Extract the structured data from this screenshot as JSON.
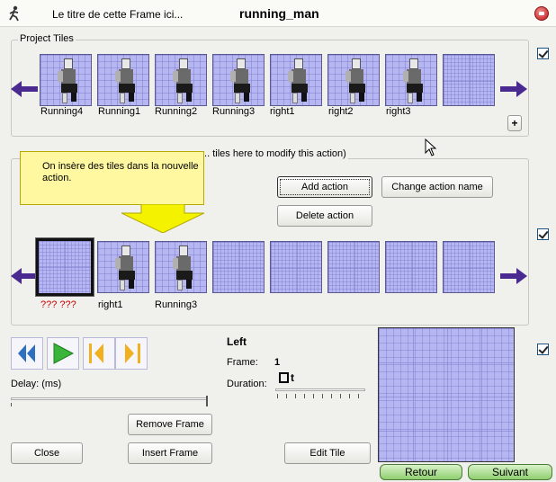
{
  "window": {
    "title": "Le titre de cette Frame ici...",
    "name": "running_man"
  },
  "project_tiles": {
    "label": "Project Tiles",
    "tiles": [
      "Running4",
      "Running1",
      "Running2",
      "Running3",
      "right1",
      "right2",
      "right3",
      ""
    ],
    "add_label": "+"
  },
  "action_group": {
    "label_visible": "... tiles here to modify this action)",
    "tooltip": "On insère des tiles dans la nouvelle action.",
    "add_action": "Add action",
    "change_action_name": "Change action name",
    "delete_action": "Delete action",
    "frames": [
      "??? ???",
      "right1",
      "Running3",
      "",
      "",
      "",
      "",
      ""
    ]
  },
  "controls": {
    "delay_label": "Delay: (ms)",
    "remove_frame": "Remove Frame",
    "insert_frame": "Insert Frame",
    "close": "Close",
    "edit_tile": "Edit Tile",
    "direction": "Left",
    "frame_label": "Frame:",
    "frame_value": "1",
    "duration_label": "Duration:",
    "duration_value": "t"
  },
  "nav": {
    "back": "Retour",
    "next": "Suivant"
  },
  "colors": {
    "tile_bg": "#b6b6f2",
    "arrow": "#4a2a90",
    "error_label": "#cc0000"
  }
}
